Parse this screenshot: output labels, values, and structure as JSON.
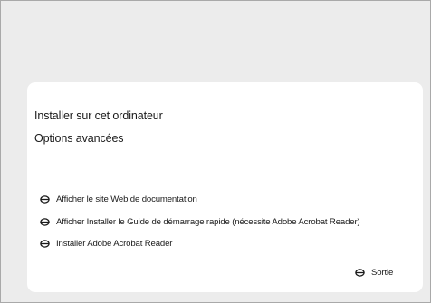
{
  "menu": {
    "install_label": "Installer  sur cet ordinateur",
    "advanced_label": "Options avancées"
  },
  "links": [
    {
      "label": "Afficher le site Web de documentation",
      "icon": "bullet-icon"
    },
    {
      "label": "Afficher Installer le Guide de démarrage rapide (nécessite Adobe Acrobat Reader)",
      "icon": "bullet-icon"
    },
    {
      "label": "Installer Adobe Acrobat Reader",
      "icon": "bullet-icon"
    }
  ],
  "exit": {
    "label": "Sortie",
    "icon": "bullet-icon"
  },
  "colors": {
    "background": "#ececec",
    "panel": "#ffffff",
    "text": "#1a1a1a",
    "border": "#a9a9a9"
  }
}
